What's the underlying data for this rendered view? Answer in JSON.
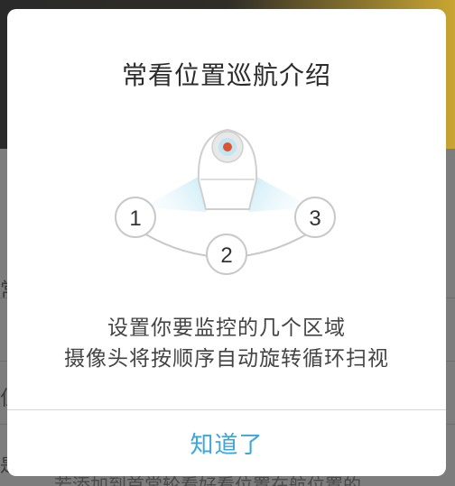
{
  "dialog": {
    "title": "常看位置巡航介绍",
    "description_line1": "设置你要监控的几个区域",
    "description_line2": "摄像头将按顺序自动旋转循环扫视",
    "confirm_label": "知道了"
  },
  "illustration": {
    "positions": [
      "1",
      "2",
      "3"
    ],
    "beam_color": "#bfe9f5",
    "camera_lens_color": "#e0532f"
  },
  "background": {
    "partial_texts": [
      "常",
      "位",
      "是",
      "若添加到首常轮看好看位置在航位置的"
    ]
  },
  "colors": {
    "accent": "#3aa6dc",
    "title": "#2b2b2b",
    "text": "#444444"
  }
}
